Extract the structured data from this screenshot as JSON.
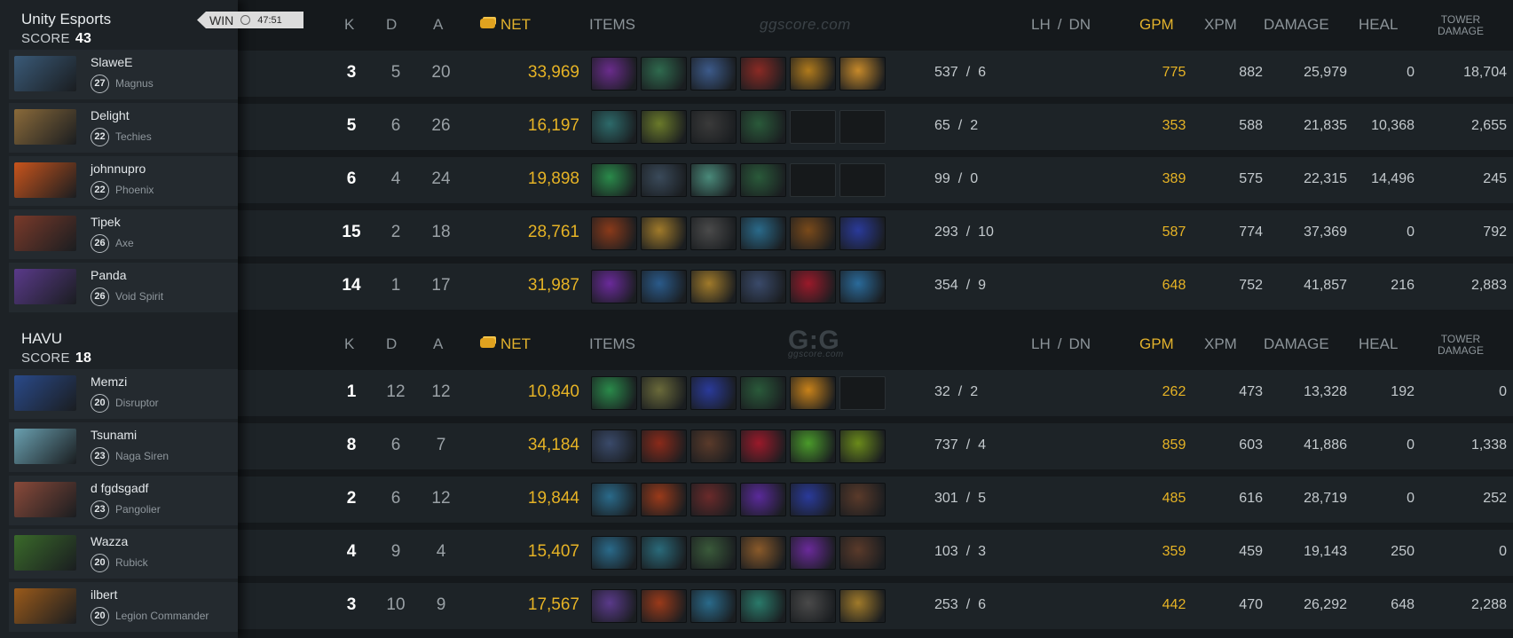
{
  "headers": {
    "k": "K",
    "d": "D",
    "a": "A",
    "net": "NET",
    "items": "ITEMS",
    "lh": "LH",
    "slash": "/",
    "dn": "DN",
    "gpm": "GPM",
    "xpm": "XPM",
    "damage": "DAMAGE",
    "heal": "HEAL",
    "tower_line1": "TOWER",
    "tower_line2": "DAMAGE"
  },
  "watermarks": {
    "top": "ggscore.com",
    "logo": "G:G",
    "logo_sub": "ggscore.com"
  },
  "match": {
    "result": "WIN",
    "duration": "47:51"
  },
  "teams": [
    {
      "name": "Unity Esports",
      "score_label": "SCORE",
      "score": "43",
      "players": [
        {
          "name": "SlaweE",
          "level": "27",
          "hero": "Magnus",
          "k": "3",
          "d": "5",
          "a": "20",
          "net": "33,969",
          "lh": "537",
          "dn": "6",
          "gpm": "775",
          "xpm": "882",
          "damage": "25,979",
          "heal": "0",
          "tower": "18,704",
          "avatar_color": "#3a5a78",
          "items": [
            "#6a2c8c",
            "#2f6a4e",
            "#3c5a8a",
            "#8a2a24",
            "#b07a1c",
            "#c6892a"
          ]
        },
        {
          "name": "Delight",
          "level": "22",
          "hero": "Techies",
          "k": "5",
          "d": "6",
          "a": "26",
          "net": "16,197",
          "lh": "65",
          "dn": "2",
          "gpm": "353",
          "xpm": "588",
          "damage": "21,835",
          "heal": "10,368",
          "tower": "2,655",
          "avatar_color": "#8a6a3a",
          "items": [
            "#2d6a6a",
            "#6a7a2a",
            "#3a3a3a",
            "#2a5a3a",
            "empty",
            "empty"
          ]
        },
        {
          "name": "johnnupro",
          "level": "22",
          "hero": "Phoenix",
          "k": "6",
          "d": "4",
          "a": "24",
          "net": "19,898",
          "lh": "99",
          "dn": "0",
          "gpm": "389",
          "xpm": "575",
          "damage": "22,315",
          "heal": "14,496",
          "tower": "245",
          "avatar_color": "#c8541c",
          "items": [
            "#2a8a4a",
            "#3a4a5a",
            "#4a8a7a",
            "#2a5a3a",
            "empty",
            "empty"
          ]
        },
        {
          "name": "Tipek",
          "level": "26",
          "hero": "Axe",
          "k": "15",
          "d": "2",
          "a": "18",
          "net": "28,761",
          "lh": "293",
          "dn": "10",
          "gpm": "587",
          "xpm": "774",
          "damage": "37,369",
          "heal": "0",
          "tower": "792",
          "avatar_color": "#7a3a2a",
          "items": [
            "#8a3a1a",
            "#a07a2a",
            "#4a4a4a",
            "#2a6a8a",
            "#7a4a1a",
            "#2a3a9a"
          ]
        },
        {
          "name": "Panda",
          "level": "26",
          "hero": "Void Spirit",
          "k": "14",
          "d": "1",
          "a": "17",
          "net": "31,987",
          "lh": "354",
          "dn": "9",
          "gpm": "648",
          "xpm": "752",
          "damage": "41,857",
          "heal": "216",
          "tower": "2,883",
          "avatar_color": "#5a3a8a",
          "items": [
            "#6a2a9a",
            "#2a5a8a",
            "#a07a2a",
            "#3a4a6a",
            "#9a1a2a",
            "#2a6a9a"
          ]
        }
      ]
    },
    {
      "name": "HAVU",
      "score_label": "SCORE",
      "score": "18",
      "players": [
        {
          "name": "Memzi",
          "level": "20",
          "hero": "Disruptor",
          "k": "1",
          "d": "12",
          "a": "12",
          "net": "10,840",
          "lh": "32",
          "dn": "2",
          "gpm": "262",
          "xpm": "473",
          "damage": "13,328",
          "heal": "192",
          "tower": "0",
          "avatar_color": "#2a4a8a",
          "items": [
            "#2a8a4a",
            "#6a6a3a",
            "#2a3a9a",
            "#2a5a3a",
            "#c8821a",
            "empty"
          ]
        },
        {
          "name": "Tsunami",
          "level": "23",
          "hero": "Naga Siren",
          "k": "8",
          "d": "6",
          "a": "7",
          "net": "34,184",
          "lh": "737",
          "dn": "4",
          "gpm": "859",
          "xpm": "603",
          "damage": "41,886",
          "heal": "0",
          "tower": "1,338",
          "avatar_color": "#6aa0b0",
          "items": [
            "#3a4a6a",
            "#8a2a1a",
            "#5a3a2a",
            "#9a1a2a",
            "#4a9a2a",
            "#6a8a1a"
          ]
        },
        {
          "name": "d fgdsgadf",
          "level": "23",
          "hero": "Pangolier",
          "k": "2",
          "d": "6",
          "a": "12",
          "net": "19,844",
          "lh": "301",
          "dn": "5",
          "gpm": "485",
          "xpm": "616",
          "damage": "28,719",
          "heal": "0",
          "tower": "252",
          "avatar_color": "#8a4a3a",
          "items": [
            "#2a6a8a",
            "#9a3a1a",
            "#6a2a2a",
            "#5a2a9a",
            "#2a3a9a",
            "#5a3a2a"
          ]
        },
        {
          "name": "Wazza",
          "level": "20",
          "hero": "Rubick",
          "k": "4",
          "d": "9",
          "a": "4",
          "net": "15,407",
          "lh": "103",
          "dn": "3",
          "gpm": "359",
          "xpm": "459",
          "damage": "19,143",
          "heal": "250",
          "tower": "0",
          "avatar_color": "#3a6a2a",
          "items": [
            "#2a6a8a",
            "#2a6a7a",
            "#3a5a3a",
            "#8a5a2a",
            "#6a2a9a",
            "#5a3a2a"
          ]
        },
        {
          "name": "ilbert",
          "level": "20",
          "hero": "Legion Commander",
          "k": "3",
          "d": "10",
          "a": "9",
          "net": "17,567",
          "lh": "253",
          "dn": "6",
          "gpm": "442",
          "xpm": "470",
          "damage": "26,292",
          "heal": "648",
          "tower": "2,288",
          "avatar_color": "#9a5a1a",
          "items": [
            "#5a3a8a",
            "#9a3a1a",
            "#2a6a8a",
            "#2a7a6a",
            "#4a4a4a",
            "#a07a2a"
          ]
        }
      ]
    }
  ]
}
